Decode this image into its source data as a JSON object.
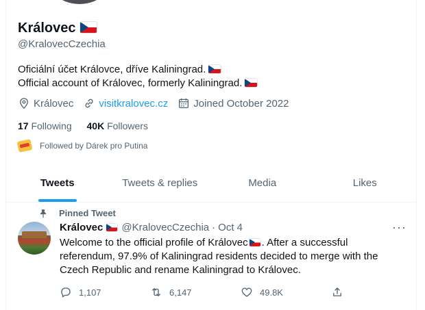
{
  "profile": {
    "name": "Královec",
    "handle": "@KralovecCzechia",
    "bio_cs": "Oficiální účet Královce, dříve Kaliningrad.",
    "bio_en": "Official account of Královec, formerly Kaliningrad.",
    "location": "Královec",
    "website": "visitkralovec.cz",
    "joined": "Joined October 2022",
    "following_count": "17",
    "following_label": "Following",
    "followers_count": "40K",
    "followers_label": "Followers",
    "followed_by": "Followed by Dárek pro Putina"
  },
  "tabs": [
    {
      "label": "Tweets",
      "active": true
    },
    {
      "label": "Tweets & replies",
      "active": false
    },
    {
      "label": "Media",
      "active": false
    },
    {
      "label": "Likes",
      "active": false
    }
  ],
  "tweet": {
    "pinned_label": "Pinned Tweet",
    "author": "Královec",
    "handle": "@KralovecCzechia",
    "separator": "·",
    "date": "Oct 4",
    "text_part1": "Welcome to the official profile of Královec",
    "text_part2": ". After a successful referendum, 97.9% of Kaliningrad residents decided to merge with the Czech Republic and rename Kaliningrad to Královec.",
    "replies": "1,107",
    "retweets": "6,147",
    "likes": "49.8K",
    "more_label": "···"
  },
  "icons": [
    "location-icon",
    "link-icon",
    "calendar-icon",
    "pin-icon",
    "reply-icon",
    "retweet-icon",
    "like-icon",
    "share-icon",
    "czech-flag-icon"
  ],
  "colors": {
    "accent": "#1d9bf0",
    "text": "#0f1419",
    "secondary": "#536471",
    "flag_blue": "#11457e",
    "flag_red": "#d7141a"
  }
}
